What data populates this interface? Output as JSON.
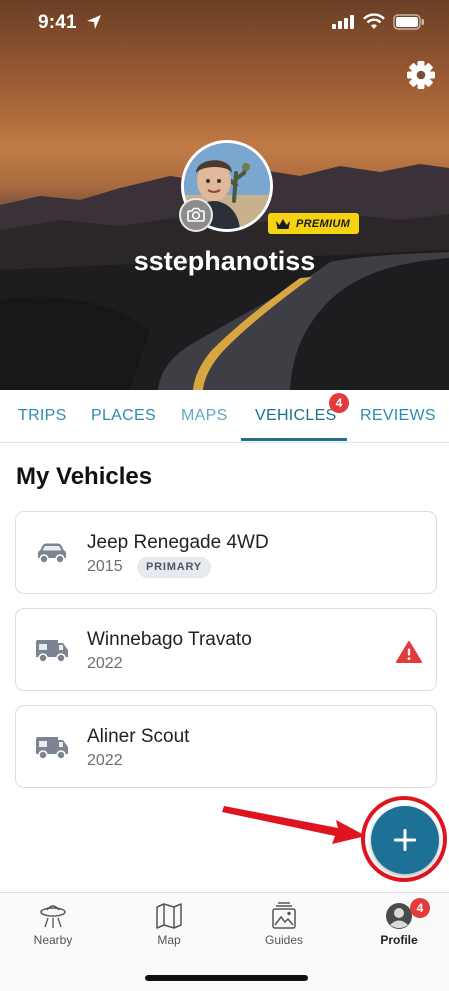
{
  "status_bar": {
    "time": "9:41"
  },
  "profile": {
    "username": "sstephanotiss",
    "premium_label": "PREMIUM"
  },
  "tabs": [
    {
      "label": "TRIPS"
    },
    {
      "label": "PLACES"
    },
    {
      "label": "MAPS"
    },
    {
      "label": "VEHICLES",
      "badge": "4",
      "active": true
    },
    {
      "label": "REVIEWS"
    }
  ],
  "section_title": "My Vehicles",
  "vehicles": [
    {
      "name": "Jeep Renegade 4WD",
      "year": "2015",
      "tag": "PRIMARY",
      "icon": "car-icon"
    },
    {
      "name": "Winnebago Travato",
      "year": "2022",
      "icon": "rv-icon",
      "warning": true
    },
    {
      "name": "Aliner Scout",
      "year": "2022",
      "icon": "rv-icon"
    }
  ],
  "bottom_nav": [
    {
      "label": "Nearby",
      "icon": "ufo-icon"
    },
    {
      "label": "Map",
      "icon": "map-icon"
    },
    {
      "label": "Guides",
      "icon": "guides-icon"
    },
    {
      "label": "Profile",
      "icon": "profile-icon",
      "badge": "4",
      "active": true
    }
  ],
  "colors": {
    "accent": "#1e7196",
    "tab": "#2c8cb3",
    "badge": "#e23b3b",
    "premium": "#f5d312",
    "highlight": "#e0141e"
  }
}
